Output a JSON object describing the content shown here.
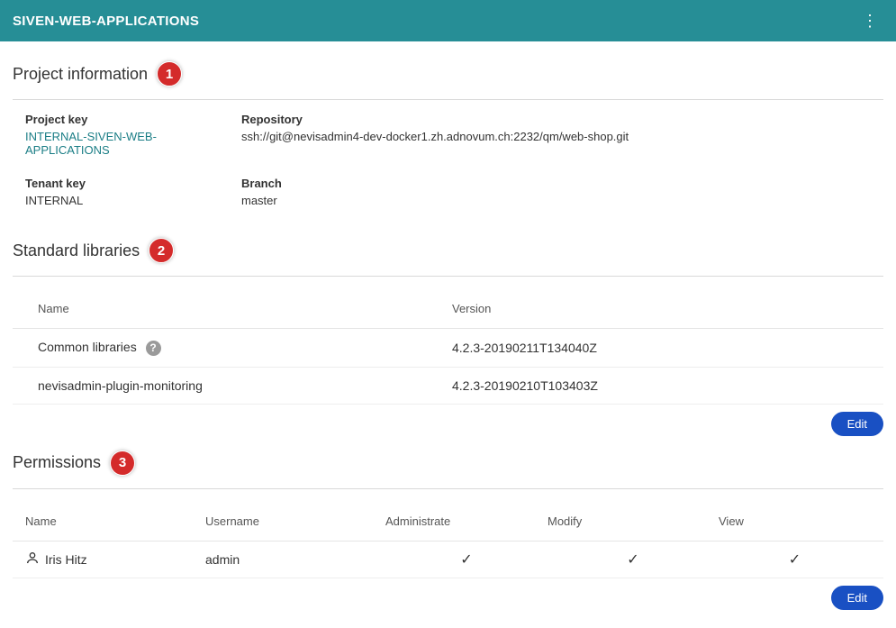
{
  "header": {
    "title": "SIVEN-WEB-APPLICATIONS"
  },
  "badges": {
    "one": "1",
    "two": "2",
    "three": "3"
  },
  "sections": {
    "project_info": {
      "title": "Project information",
      "project_key_label": "Project key",
      "project_key_value": "INTERNAL-SIVEN-WEB-APPLICATIONS",
      "repository_label": "Repository",
      "repository_value": "ssh://git@nevisadmin4-dev-docker1.zh.adnovum.ch:2232/qm/web-shop.git",
      "tenant_key_label": "Tenant key",
      "tenant_key_value": "INTERNAL",
      "branch_label": "Branch",
      "branch_value": "master"
    },
    "libraries": {
      "title": "Standard libraries",
      "col_name": "Name",
      "col_version": "Version",
      "rows": [
        {
          "name": "Common libraries",
          "version": "4.2.3-20190211T134040Z",
          "info": true
        },
        {
          "name": "nevisadmin-plugin-monitoring",
          "version": "4.2.3-20190210T103403Z",
          "info": false
        }
      ],
      "edit_label": "Edit"
    },
    "permissions": {
      "title": "Permissions",
      "col_name": "Name",
      "col_user": "Username",
      "col_admin": "Administrate",
      "col_modify": "Modify",
      "col_view": "View",
      "rows": [
        {
          "name": "Iris Hitz",
          "username": "admin",
          "admin": true,
          "modify": true,
          "view": true
        }
      ],
      "edit_label": "Edit"
    }
  }
}
